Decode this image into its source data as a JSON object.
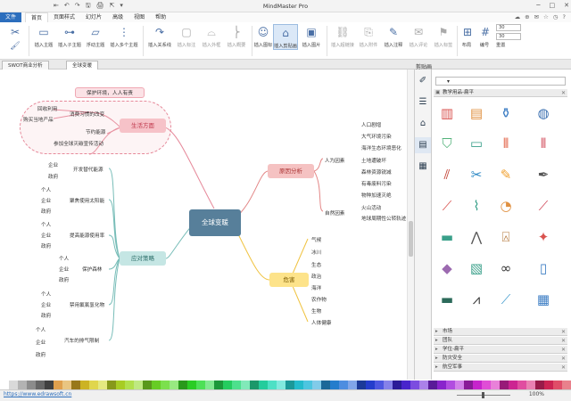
{
  "app": {
    "title": "MindMaster Pro"
  },
  "quick_access": [
    "⇤",
    "↶",
    "↷",
    "🖫",
    "🖨",
    "⇱",
    "▾"
  ],
  "menu": {
    "items": [
      "文件",
      "首页",
      "页面样式",
      "幻灯片",
      "高级",
      "视图",
      "帮助"
    ],
    "active": "首页"
  },
  "menu_right": [
    "☁",
    "⊕",
    "✉",
    "☆",
    "◷",
    "?"
  ],
  "window_controls": [
    "─",
    "□",
    "✕"
  ],
  "ribbon": {
    "buttons": [
      {
        "label": "插入主题",
        "icon": "insert-topic-icon",
        "glyph": "▭"
      },
      {
        "label": "插入子主题",
        "icon": "insert-subtopic-icon",
        "glyph": "⊶"
      },
      {
        "label": "浮动主题",
        "icon": "floating-topic-icon",
        "glyph": "▱"
      },
      {
        "label": "插入多个主题",
        "icon": "insert-multiple-icon",
        "glyph": "⋮"
      },
      {
        "label": "插入关系线",
        "icon": "relationship-icon",
        "glyph": "↷"
      },
      {
        "label": "插入标注",
        "icon": "callout-icon",
        "glyph": "▢"
      },
      {
        "label": "插入外框",
        "icon": "boundary-icon",
        "glyph": "⌓"
      },
      {
        "label": "插入概要",
        "icon": "summary-icon",
        "glyph": "⎬"
      },
      {
        "label": "插入图标",
        "icon": "icon-insert-icon",
        "glyph": "☺"
      },
      {
        "label": "插入剪贴画",
        "icon": "clipart-icon",
        "glyph": "⌂"
      },
      {
        "label": "插入图片",
        "icon": "picture-icon",
        "glyph": "▣"
      },
      {
        "label": "插入超链接",
        "icon": "hyperlink-icon",
        "glyph": "⛓"
      },
      {
        "label": "插入附件",
        "icon": "attachment-icon",
        "glyph": "⎘"
      },
      {
        "label": "插入注释",
        "icon": "note-icon",
        "glyph": "✎"
      },
      {
        "label": "插入评论",
        "icon": "comment-icon",
        "glyph": "✉"
      },
      {
        "label": "插入标签",
        "icon": "tag-icon",
        "glyph": "⚑"
      },
      {
        "label": "布局",
        "icon": "layout-icon",
        "glyph": "⊞"
      },
      {
        "label": "编号",
        "icon": "numbering-icon",
        "glyph": "#"
      }
    ],
    "spin1": "30",
    "spin2": "30",
    "reset": "重置"
  },
  "tabs": [
    "SWOT商业分析",
    "全球变暖"
  ],
  "active_tab": "全球变暖",
  "panel": {
    "title": "剪贴画",
    "library": "教学用品-扁平",
    "categories": [
      "市场",
      "团队",
      "学位-扁平",
      "防灾安全",
      "航空军事"
    ]
  },
  "mindmap": {
    "central": "全球变暖",
    "main": {
      "life": "生活方面",
      "cause": "原因分析",
      "danger": "危害",
      "strategy": "应对策略"
    },
    "life_callout": "保护环境，人人有责",
    "life": [
      "回收利用",
      "购买当地产品",
      "消费习惯的改变",
      "节约能源",
      "参加全球灭碳宣传活动"
    ],
    "cause": {
      "human": "人为因素",
      "human_items": [
        "人口剧增",
        "大气环境污染",
        "海洋生态环境恶化",
        "土地遭破坏",
        "森林资源锐减",
        "有毒废料污染",
        "物种加速灭绝"
      ],
      "natural": "自然因素",
      "natural_items": [
        "火山活动",
        "地球周期性公转轨迹"
      ]
    },
    "danger": [
      "气候",
      "冰川",
      "生态",
      "政治",
      "海洋",
      "农作物",
      "生物",
      "人体健康"
    ],
    "strategy": {
      "groups": [
        {
          "label": "开发替代能源",
          "subs": [
            "企业",
            "政府"
          ]
        },
        {
          "label": "聚焦使用太阳能",
          "subs": [
            "个人",
            "企业",
            "政府"
          ]
        },
        {
          "label": "提高能源使用率",
          "subs": [
            "个人",
            "企业",
            "政府"
          ]
        },
        {
          "label": "保护森林",
          "subs": [
            "个人",
            "企业",
            "政府"
          ]
        },
        {
          "label": "禁用氟氯氢化物",
          "subs": [
            "个人",
            "企业",
            "政府"
          ]
        },
        {
          "label": "汽车的排气限制",
          "subs": [
            "个人",
            "企业",
            "政府"
          ]
        }
      ]
    }
  },
  "status": {
    "url": "https://www.edrawsoft.cn",
    "zoom": "100%"
  },
  "colors": {
    "accent": "#2c6ebd",
    "central": "#577f9a",
    "life": "#f6c2c8",
    "cause": "#f5c2c2",
    "danger": "#fde38a",
    "strategy": "#c5e6e4"
  }
}
